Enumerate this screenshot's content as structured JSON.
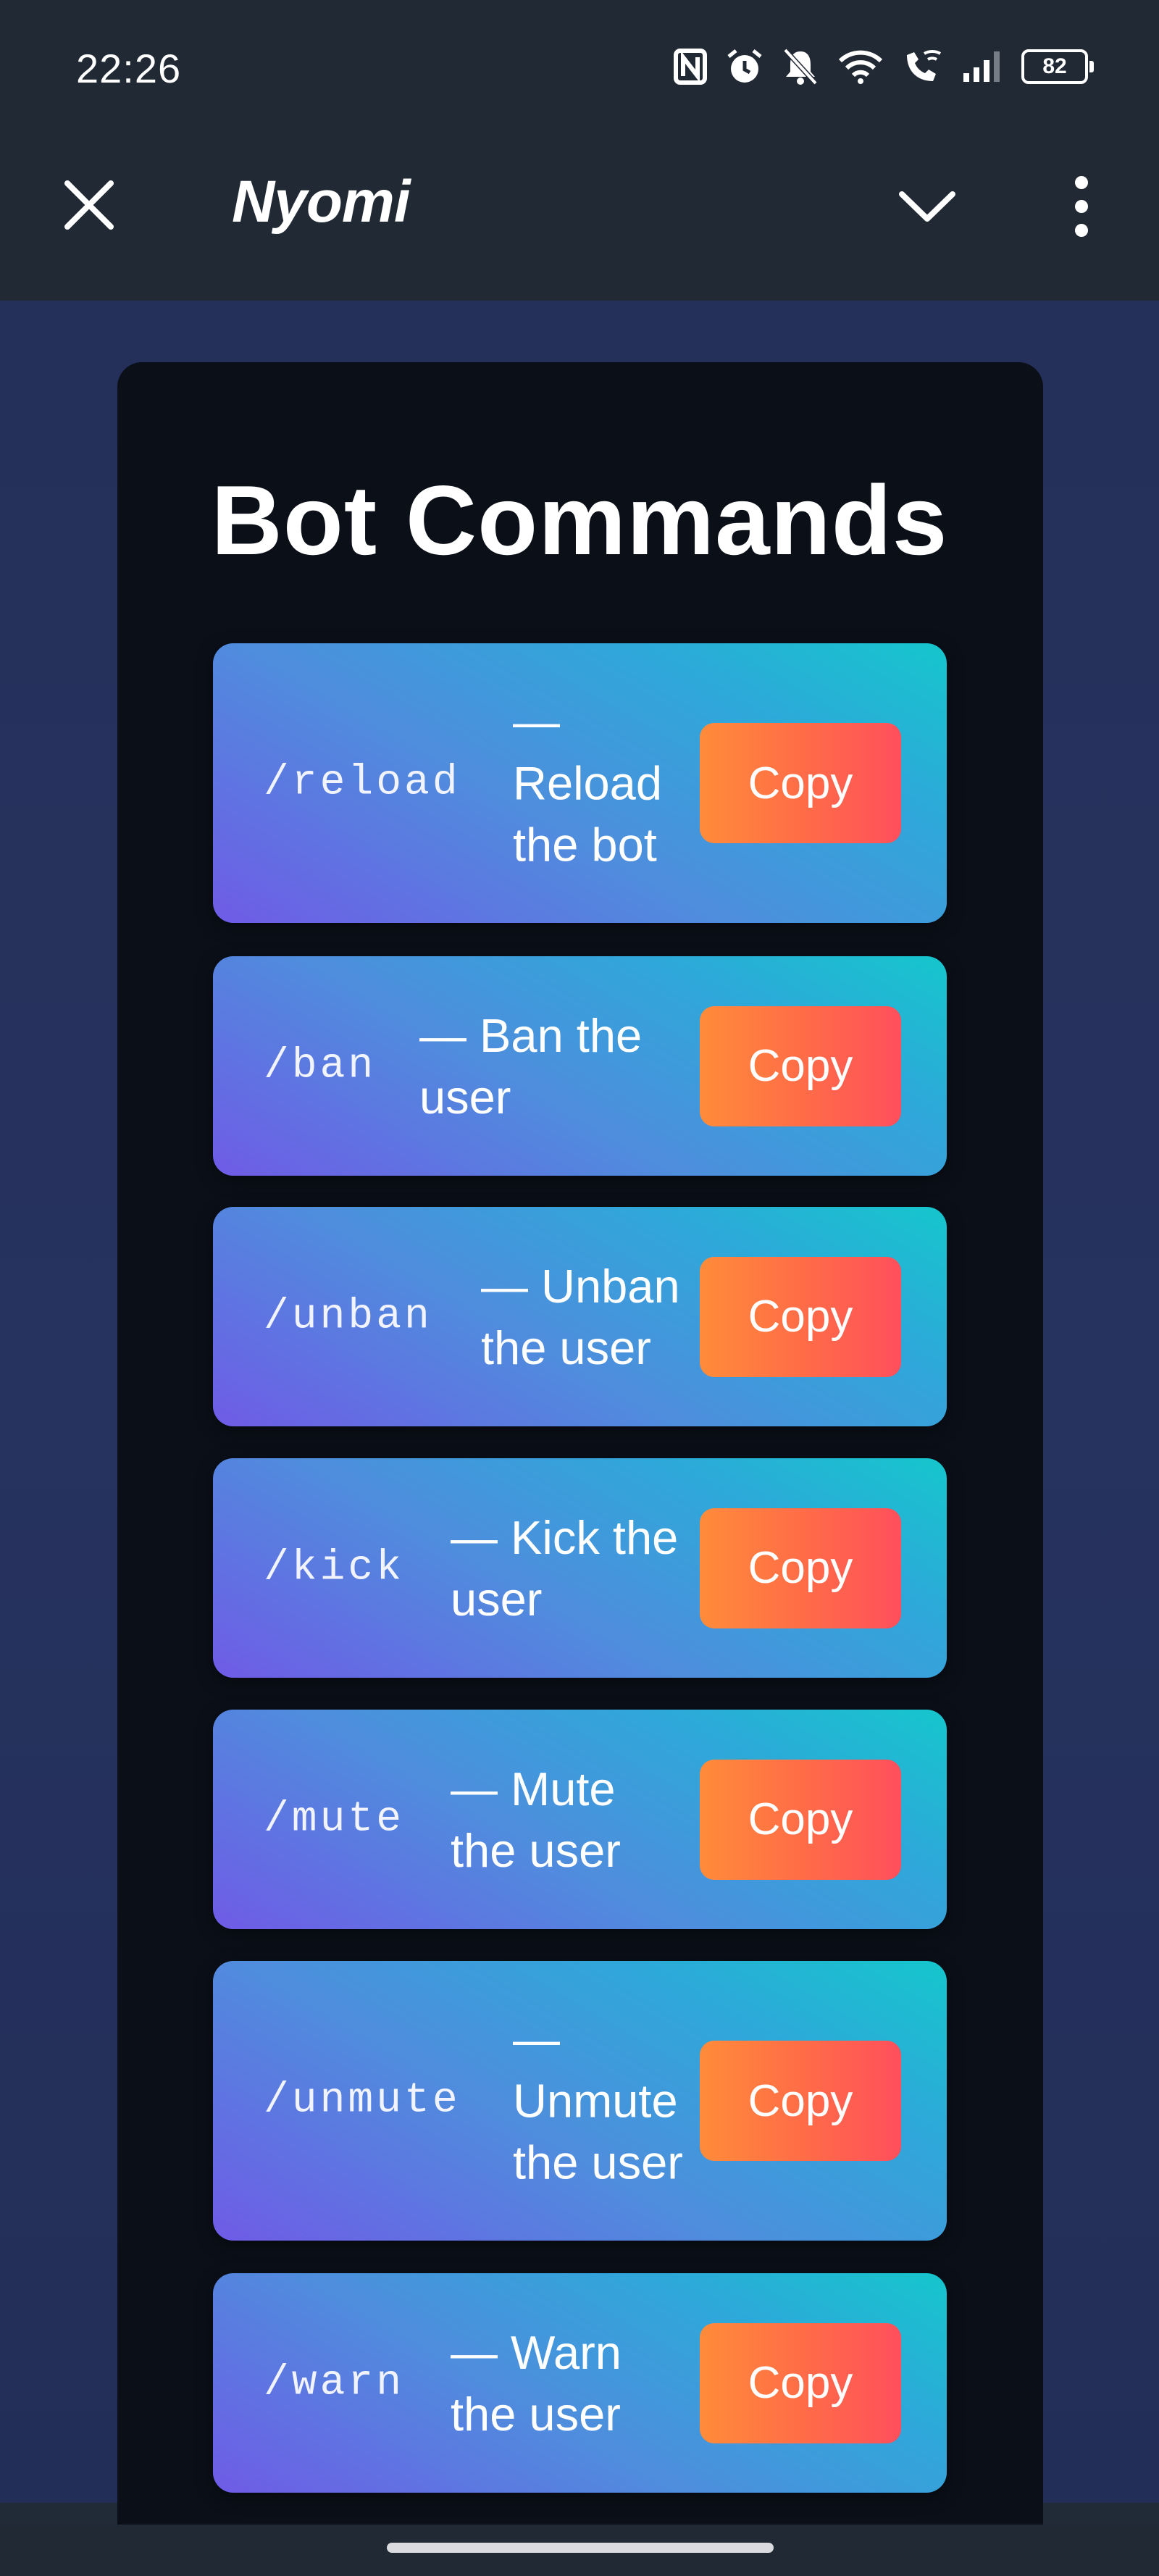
{
  "status_bar": {
    "time": "22:26",
    "battery": "82",
    "icons": [
      "nfc-icon",
      "alarm-icon",
      "mute-bell-icon",
      "wifi-icon",
      "wifi-calling-icon",
      "signal-icon",
      "battery-icon"
    ]
  },
  "app_bar": {
    "title": "Nyomi",
    "icons": [
      "close-icon",
      "chevron-down-icon",
      "more-vertical-icon"
    ]
  },
  "panel": {
    "title": "Bot Commands",
    "commands": [
      {
        "command": "/reload",
        "desc_line1": "—",
        "desc_line2": "Reload",
        "desc_line3": "the bot",
        "copy_label": "Copy"
      },
      {
        "command": "/ban",
        "desc_line1": "— Ban the",
        "desc_line2": "user",
        "copy_label": "Copy"
      },
      {
        "command": "/unban",
        "desc_line1": "— Unban",
        "desc_line2": "the user",
        "copy_label": "Copy"
      },
      {
        "command": "/kick",
        "desc_line1": "— Kick the",
        "desc_line2": "user",
        "copy_label": "Copy"
      },
      {
        "command": "/mute",
        "desc_line1": "— Mute",
        "desc_line2": "the user",
        "copy_label": "Copy"
      },
      {
        "command": "/unmute",
        "desc_line1": "—",
        "desc_line2": "Unmute",
        "desc_line3": "the user",
        "copy_label": "Copy"
      },
      {
        "command": "/warn",
        "desc_line1": "— Warn",
        "desc_line2": "the user",
        "copy_label": "Copy"
      }
    ]
  },
  "colors": {
    "app_bar": "#212934",
    "background": "#26335e",
    "panel": "#0b0f18",
    "card_gradient_start": "#6f5be6",
    "card_gradient_end": "#15c6cd",
    "copy_gradient_start": "#ff8c3a",
    "copy_gradient_end": "#ff4f5c"
  }
}
